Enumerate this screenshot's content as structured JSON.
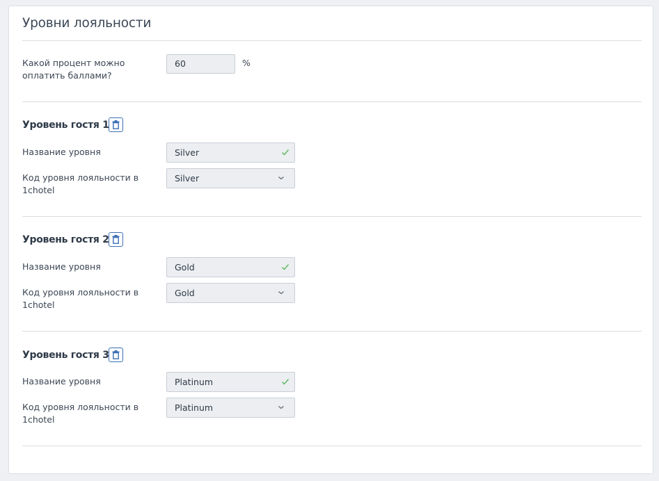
{
  "page": {
    "title": "Уровни лояльности"
  },
  "payment": {
    "label": "Какой процент можно оплатить баллами?",
    "value": "60",
    "unit": "%"
  },
  "levels": [
    {
      "title": "Уровень гостя 1",
      "name_label": "Название уровня",
      "name_value": "Silver",
      "code_label": "Код уровня лояльности в 1chotel",
      "code_value": "Silver"
    },
    {
      "title": "Уровень гостя 2",
      "name_label": "Название уровня",
      "name_value": "Gold",
      "code_label": "Код уровня лояльности в 1chotel",
      "code_value": "Gold"
    },
    {
      "title": "Уровень гостя 3",
      "name_label": "Название уровня",
      "name_value": "Platinum",
      "code_label": "Код уровня лояльности в 1chotel",
      "code_value": "Platinum"
    }
  ],
  "icons": {
    "delete": "trash-icon",
    "valid": "check-icon",
    "dropdown": "chevron-down-icon"
  },
  "colors": {
    "accent": "#3d6fb5",
    "valid": "#5cb85c",
    "input_bg": "#eceef1"
  }
}
